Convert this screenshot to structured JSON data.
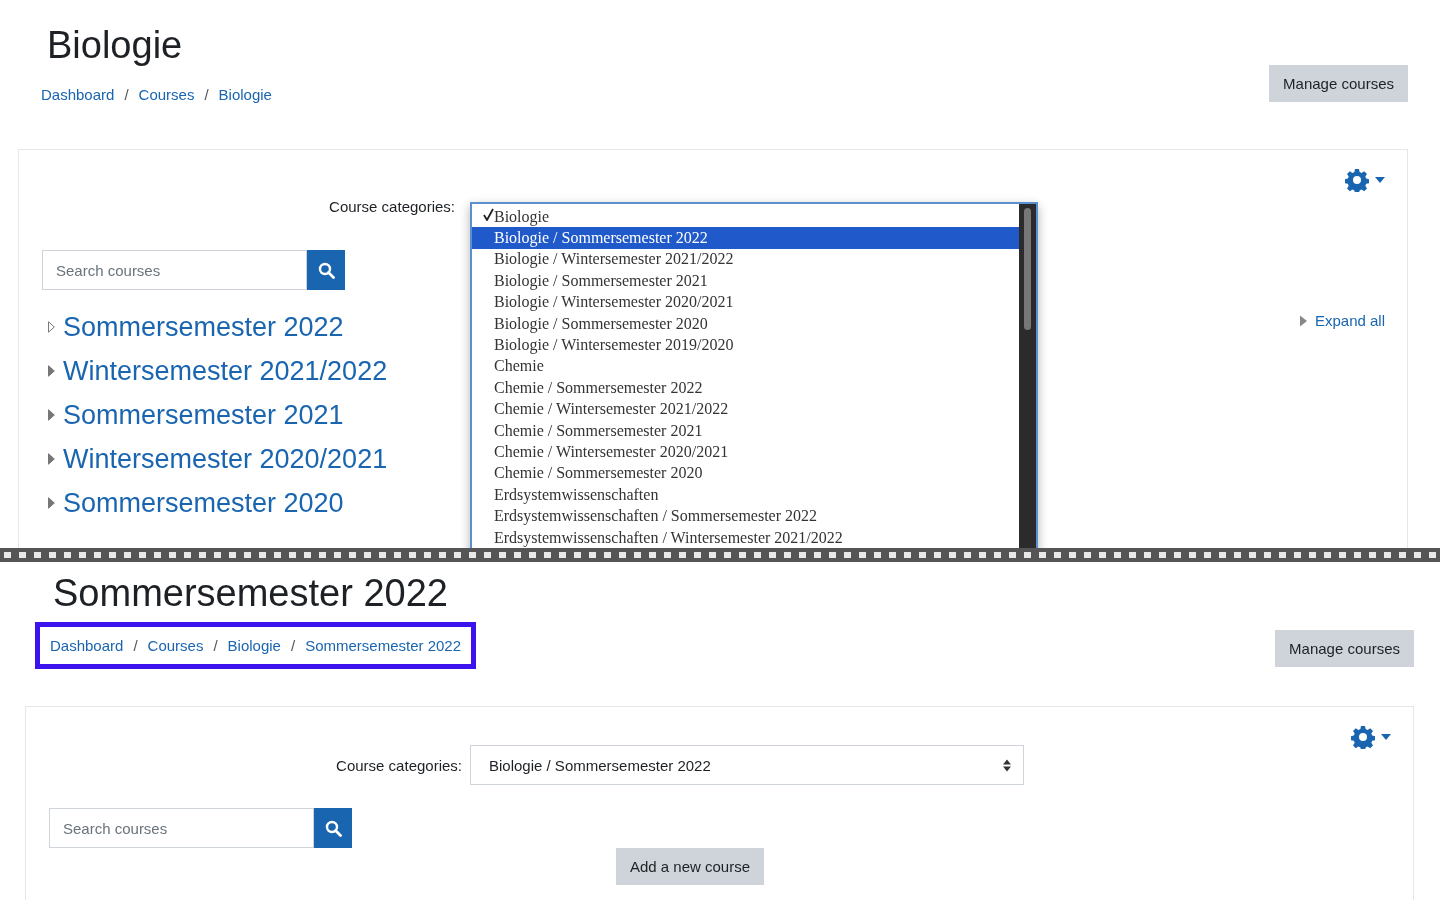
{
  "top": {
    "title": "Biologie",
    "breadcrumb": [
      "Dashboard",
      "Courses",
      "Biologie"
    ],
    "breadcrumb_separator": "/",
    "manage_button": "Manage courses",
    "category_label": "Course categories:",
    "category_options": [
      {
        "label": "Biologie",
        "checked": true,
        "selected": false
      },
      {
        "label": "Biologie / Sommersemester 2022",
        "checked": false,
        "selected": true
      },
      {
        "label": "Biologie / Wintersemester 2021/2022",
        "checked": false,
        "selected": false
      },
      {
        "label": "Biologie / Sommersemester 2021",
        "checked": false,
        "selected": false
      },
      {
        "label": "Biologie / Wintersemester 2020/2021",
        "checked": false,
        "selected": false
      },
      {
        "label": "Biologie / Sommersemester 2020",
        "checked": false,
        "selected": false
      },
      {
        "label": "Biologie / Wintersemester 2019/2020",
        "checked": false,
        "selected": false
      },
      {
        "label": "Chemie",
        "checked": false,
        "selected": false
      },
      {
        "label": "Chemie / Sommersemester 2022",
        "checked": false,
        "selected": false
      },
      {
        "label": "Chemie / Wintersemester 2021/2022",
        "checked": false,
        "selected": false
      },
      {
        "label": "Chemie / Sommersemester 2021",
        "checked": false,
        "selected": false
      },
      {
        "label": "Chemie / Wintersemester 2020/2021",
        "checked": false,
        "selected": false
      },
      {
        "label": "Chemie / Sommersemester 2020",
        "checked": false,
        "selected": false
      },
      {
        "label": "Erdsystemwissenschaften",
        "checked": false,
        "selected": false
      },
      {
        "label": "Erdsystemwissenschaften / Sommersemester 2022",
        "checked": false,
        "selected": false
      },
      {
        "label": "Erdsystemwissenschaften / Wintersemester 2021/2022",
        "checked": false,
        "selected": false
      }
    ],
    "search": {
      "placeholder": "Search courses"
    },
    "expand_all": "Expand all",
    "categories": [
      {
        "label": "Sommersemester 2022",
        "focused": true
      },
      {
        "label": "Wintersemester 2021/2022",
        "focused": false
      },
      {
        "label": "Sommersemester 2021",
        "focused": false
      },
      {
        "label": "Wintersemester 2020/2021",
        "focused": false
      },
      {
        "label": "Sommersemester 2020",
        "focused": false
      }
    ]
  },
  "bottom": {
    "title": "Sommersemester 2022",
    "breadcrumb": [
      "Dashboard",
      "Courses",
      "Biologie",
      "Sommersemester 2022"
    ],
    "breadcrumb_separator": "/",
    "breadcrumb_highlighted": true,
    "manage_button": "Manage courses",
    "category_label": "Course categories:",
    "category_value": "Biologie / Sommersemester 2022",
    "search": {
      "placeholder": "Search courses"
    },
    "add_button": "Add a new course"
  }
}
